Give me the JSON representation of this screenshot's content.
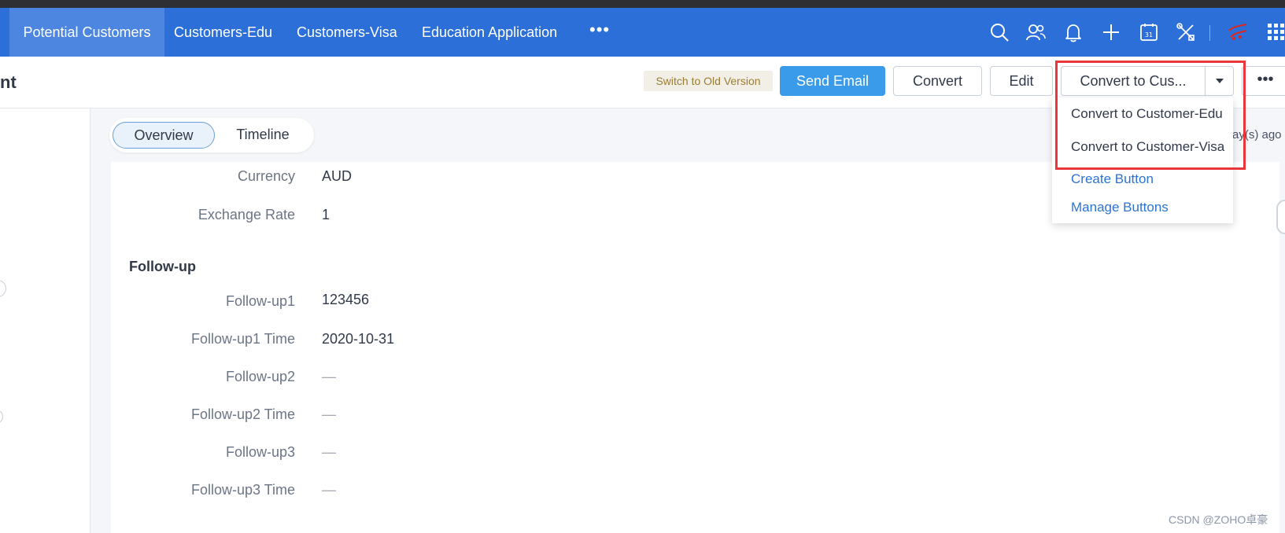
{
  "nav": {
    "tabs": [
      {
        "label": "Potential Customers",
        "active": true
      },
      {
        "label": "Customers-Edu",
        "active": false
      },
      {
        "label": "Customers-Visa",
        "active": false
      },
      {
        "label": "Education Application",
        "active": false
      }
    ],
    "more_label": "•••",
    "icons": [
      "search-icon",
      "contacts-icon",
      "bell-icon",
      "plus-icon",
      "calendar-icon",
      "tools-icon",
      "brand-logo-icon",
      "apps-grid-icon"
    ],
    "calendar_day": "31",
    "accent_color": "#2d6fd9"
  },
  "header": {
    "title": "nt",
    "switch_old_version": "Switch to Old Version",
    "send_email": "Send Email",
    "convert": "Convert",
    "edit": "Edit",
    "convert_split": "Convert to Cus...",
    "more": "•••"
  },
  "view_toggle": {
    "tabs": [
      {
        "label": "Overview",
        "active": true
      },
      {
        "label": "Timeline",
        "active": false
      }
    ]
  },
  "modified_text": "ay(s) ago",
  "dropdown": {
    "items": [
      {
        "label": "Convert to Customer-Edu",
        "kind": "action"
      },
      {
        "label": "Convert to Customer-Visa",
        "kind": "action"
      },
      {
        "label": "Create Button",
        "kind": "link"
      },
      {
        "label": "Manage Buttons",
        "kind": "link"
      }
    ]
  },
  "details": {
    "currency_label": "Currency",
    "currency_value": "AUD",
    "exchange_label": "Exchange Rate",
    "exchange_value": "1",
    "section_title": "Follow-up",
    "followup_rows": [
      {
        "label": "Follow-up1",
        "value": "123456"
      },
      {
        "label": "Follow-up1 Time",
        "value": "2020-10-31"
      },
      {
        "label": "Follow-up2",
        "value": "—"
      },
      {
        "label": "Follow-up2 Time",
        "value": "—"
      },
      {
        "label": "Follow-up3",
        "value": "—"
      },
      {
        "label": "Follow-up3 Time",
        "value": "—"
      }
    ]
  },
  "watermark": "CSDN @ZOHO卓豪"
}
